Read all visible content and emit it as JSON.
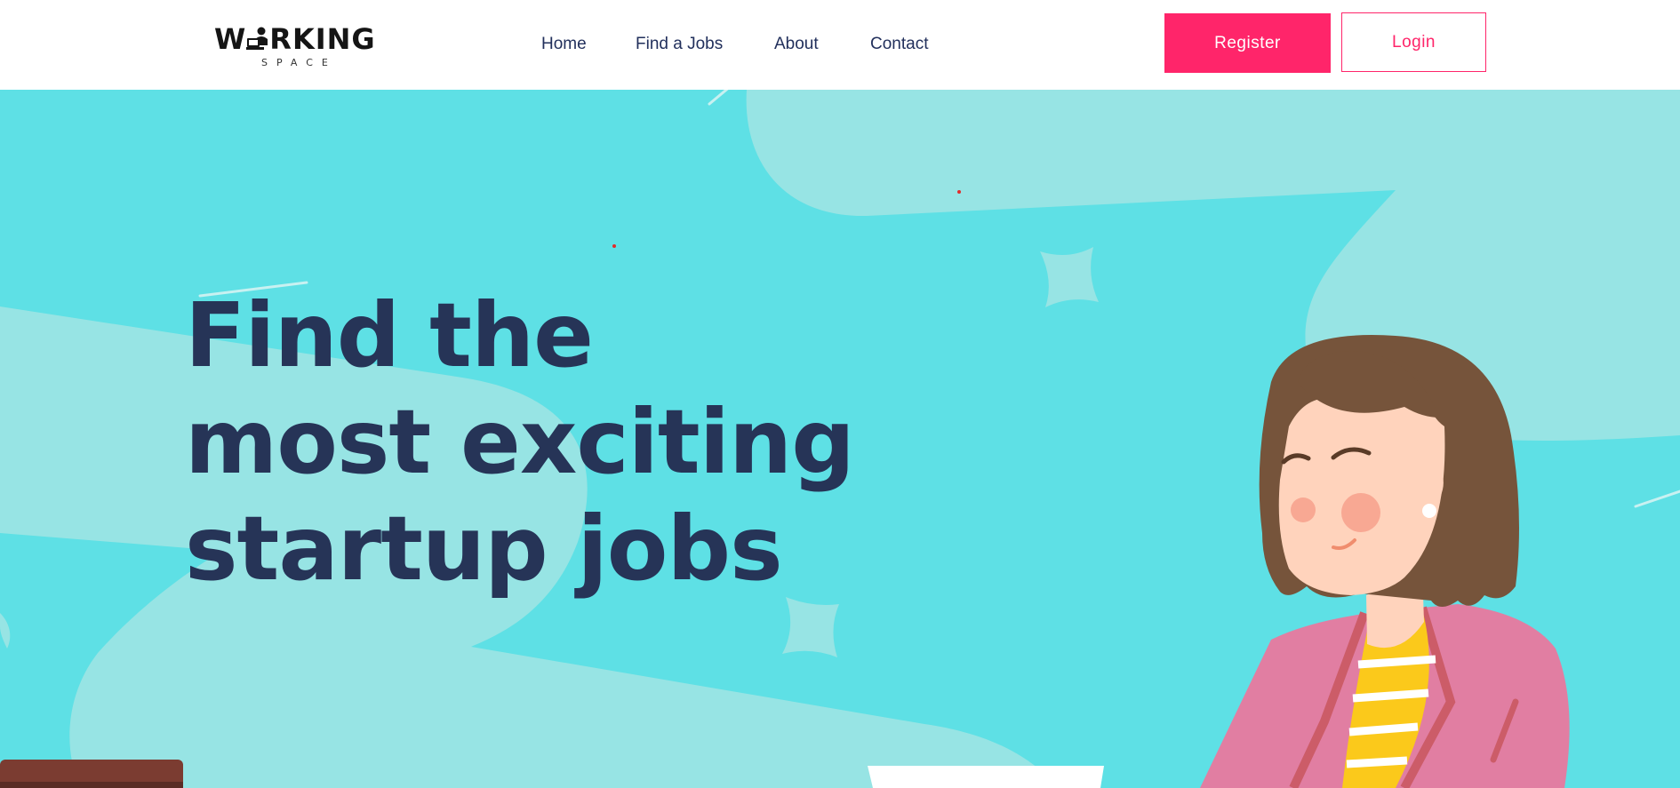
{
  "brand": {
    "logo_main_pre": "W",
    "logo_main_post": "RKING",
    "logo_sub": "SPACE"
  },
  "nav": {
    "links": [
      {
        "label": "Home"
      },
      {
        "label": "Find a Jobs"
      },
      {
        "label": "About"
      },
      {
        "label": "Contact"
      }
    ],
    "register_label": "Register",
    "login_label": "Login"
  },
  "hero": {
    "heading_lines": [
      "Find the",
      "most exciting",
      "startup jobs"
    ]
  },
  "colors": {
    "accent": "#ff256a",
    "heading": "#263457",
    "hero_bg": "#5ee0e5",
    "nav_text": "#22305c"
  },
  "icons": [
    "laptop-person-logo-icon",
    "sparkle-icon",
    "woman-illustration"
  ]
}
